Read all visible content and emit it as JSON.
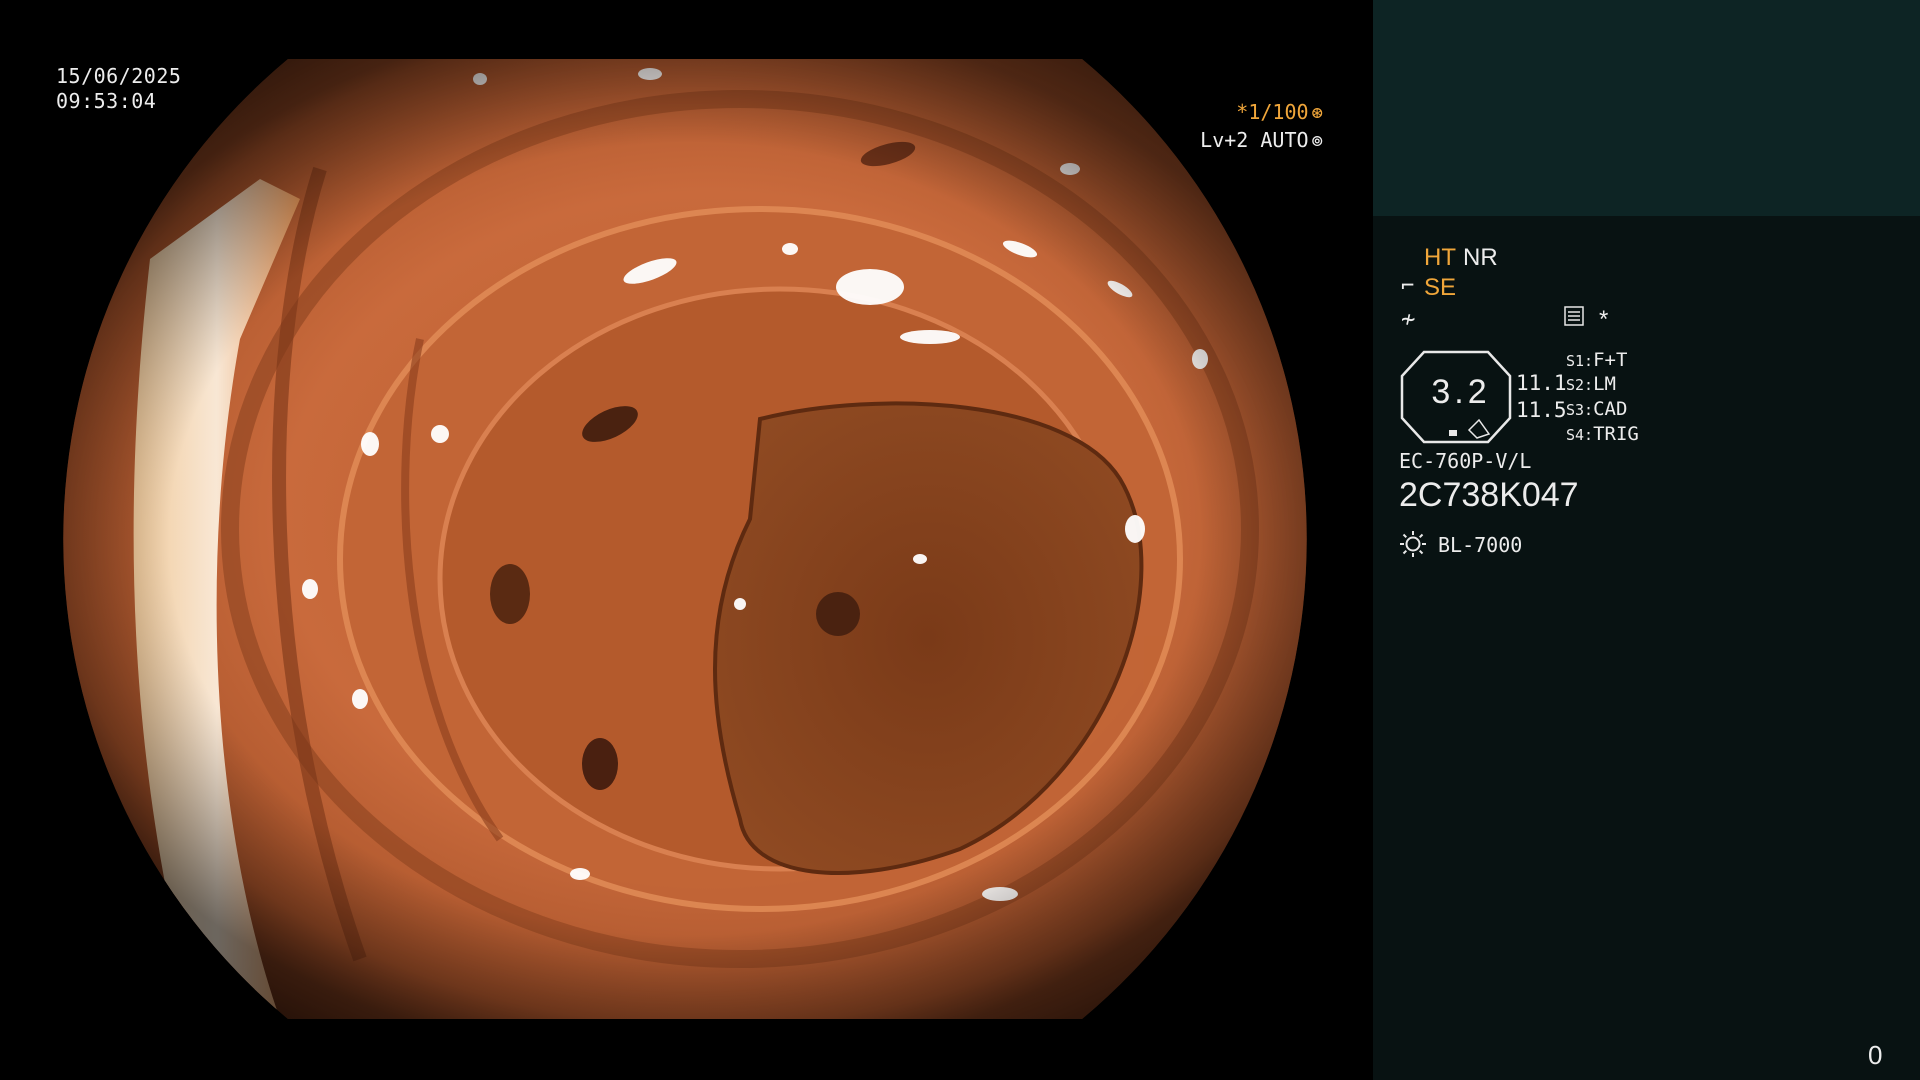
{
  "video": {
    "date": "15/06/2025",
    "time": "09:53:04",
    "shutter": "*1/100",
    "shutter_icon": "aperture-icon",
    "level": "Lv+2 AUTO",
    "level_icon": "iris-icon",
    "scene": "colon-lumen-endoscopic-view"
  },
  "panel": {
    "ht": "HT",
    "nr": "NR",
    "se": "SE",
    "se_icon": "scope-angle-icon",
    "wave_icon": "signal-wave-icon",
    "menu_icon": "document-menu-icon",
    "star": "*",
    "gauge_value": "3.2",
    "value_1": "11.1",
    "value_2": "11.5",
    "switches": [
      {
        "key": "S1:",
        "value": "F+T"
      },
      {
        "key": "S2:",
        "value": "LM"
      },
      {
        "key": "S3:",
        "value": "CAD"
      },
      {
        "key": "S4:",
        "value": "TRIG"
      }
    ],
    "model": "EC-760P-V/L",
    "serial": "2C738K047",
    "light_icon": "light-source-icon",
    "light_source": "BL-7000",
    "corner_value": "0",
    "colors": {
      "accent": "#f0a63a",
      "panel_bg": "#081212",
      "panel_top_bg": "#0d2424"
    }
  }
}
